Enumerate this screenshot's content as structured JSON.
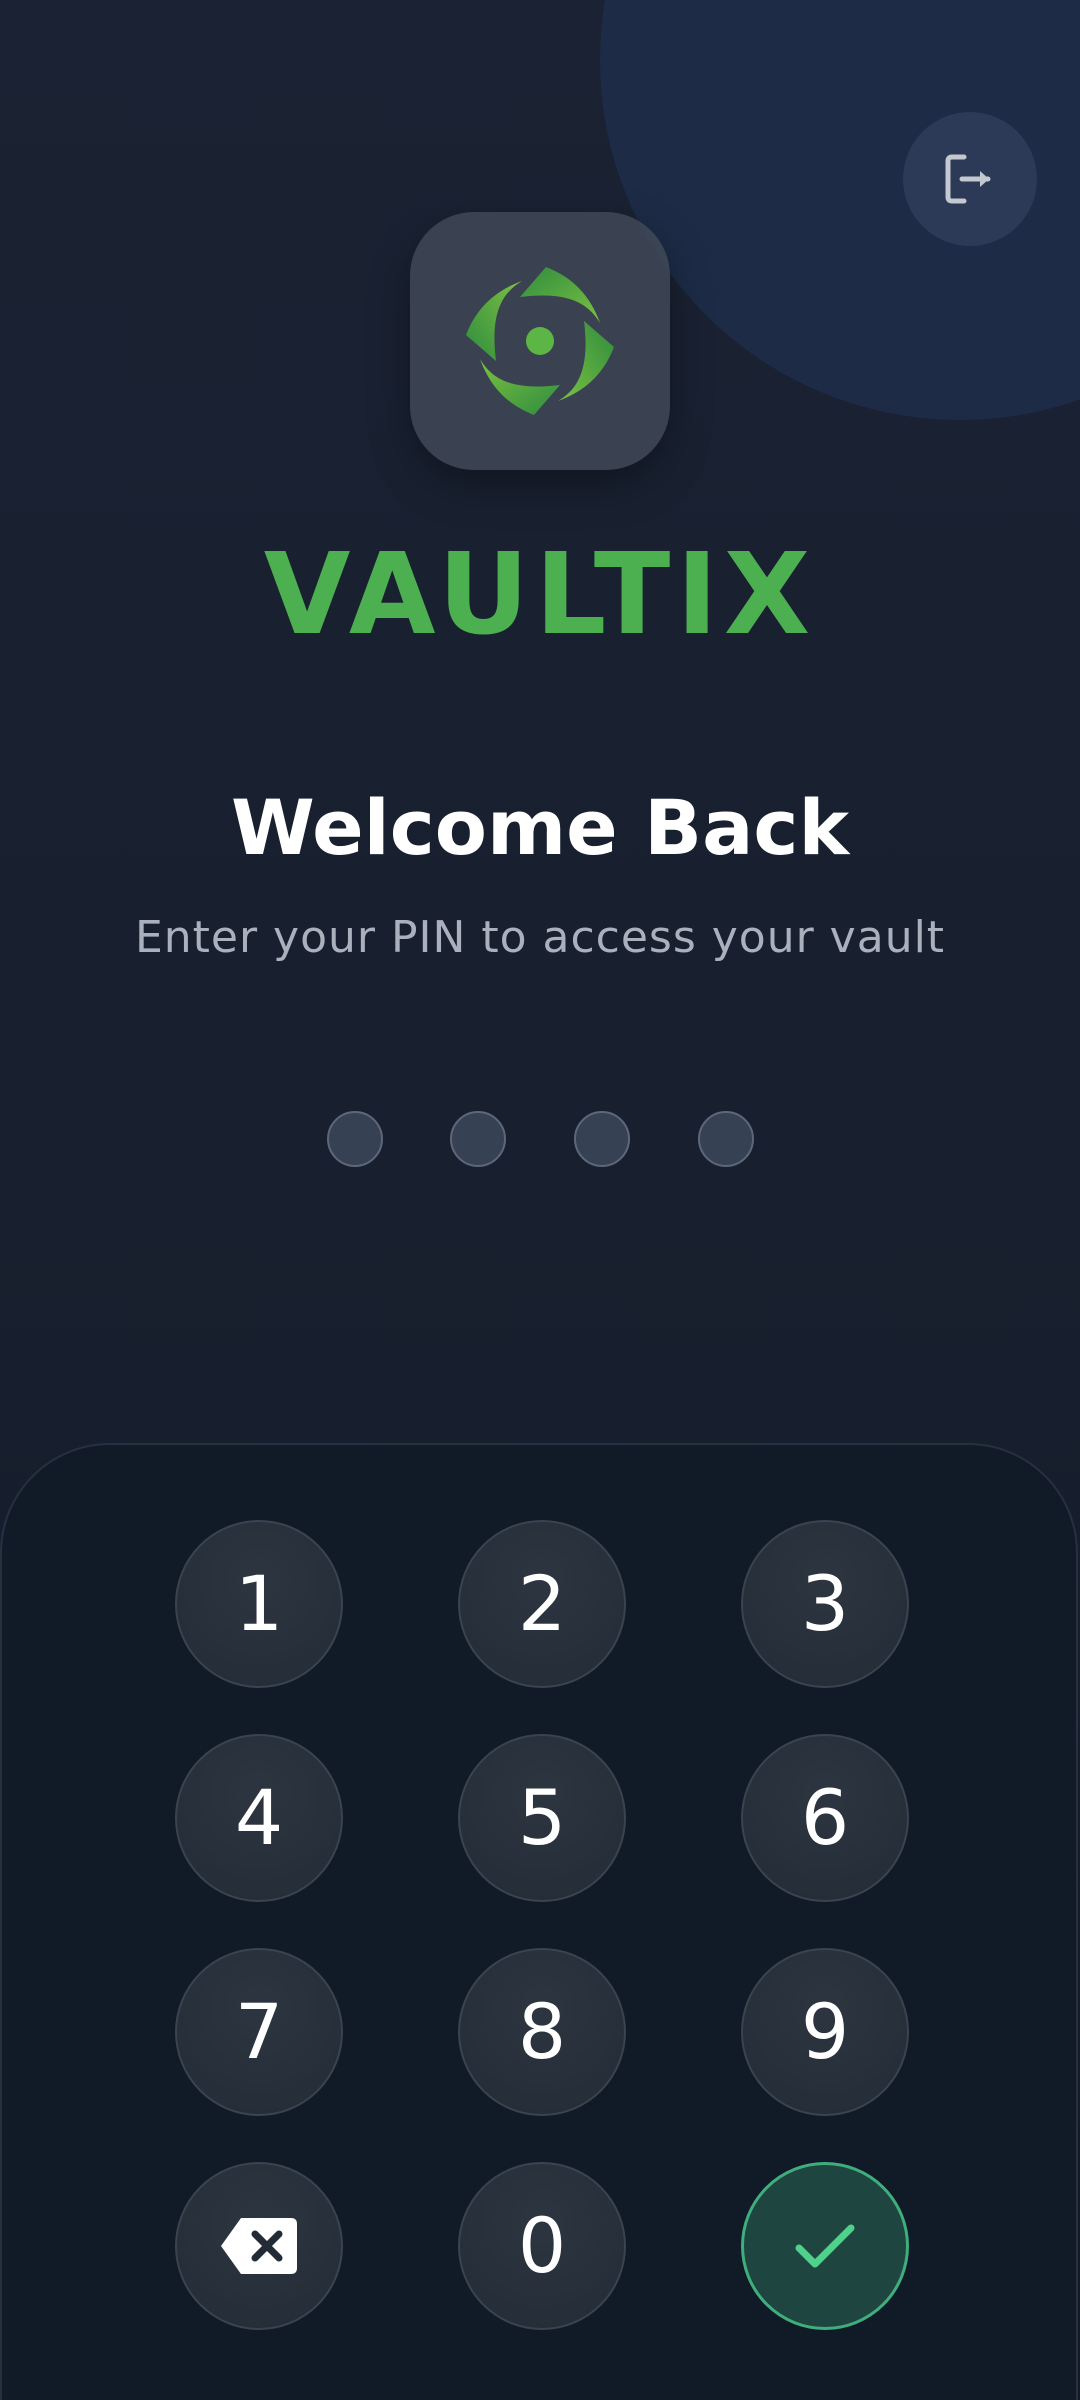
{
  "app": {
    "brand_name": "VAULTIX",
    "accent_color": "#4caf50"
  },
  "header": {
    "logout_icon": "logout-icon"
  },
  "lock_screen": {
    "title": "Welcome Back",
    "subtitle": "Enter your PIN to access your vault",
    "pin_length": 4,
    "pin_entered": 0
  },
  "keypad": {
    "keys": {
      "k1": "1",
      "k2": "2",
      "k3": "3",
      "k4": "4",
      "k5": "5",
      "k6": "6",
      "k7": "7",
      "k8": "8",
      "k9": "9",
      "k0": "0"
    },
    "backspace_icon": "backspace-icon",
    "confirm_icon": "check-icon",
    "confirm_color": "#3fae7d"
  }
}
